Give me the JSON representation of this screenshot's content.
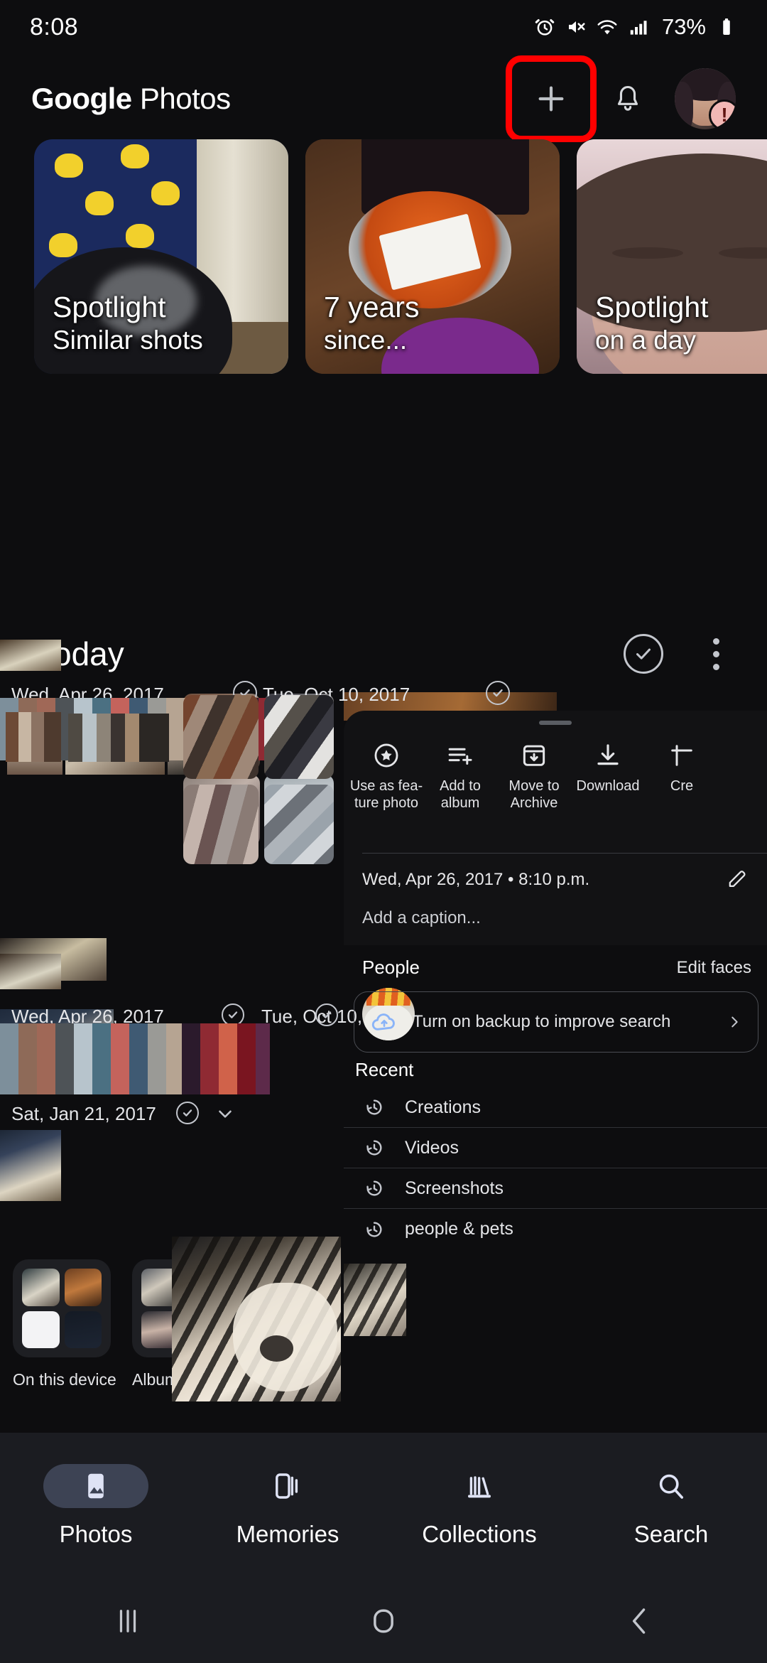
{
  "status_bar": {
    "time": "8:08",
    "battery": "73%",
    "icons": [
      "alarm-icon",
      "mute-icon",
      "wifi-icon",
      "signal-icon",
      "battery-icon"
    ]
  },
  "app_bar": {
    "brand_bold": "Google",
    "brand_light": " Photos",
    "add_label": "+",
    "highlight_color": "#ff0000",
    "notification_badge": "!"
  },
  "memories": [
    {
      "line1": "Spotlight",
      "line2": "Similar shots"
    },
    {
      "line1": "7 years",
      "line2": "since..."
    },
    {
      "line1": "Spotlight",
      "line2": "on a day"
    }
  ],
  "section": {
    "title": "Today"
  },
  "date_labels": [
    {
      "text": "Wed, Apr 26, 2017"
    },
    {
      "text": "Tue, Oct 10, 2017"
    },
    {
      "text": "Sat, Jan 21, 2017"
    }
  ],
  "overlay": {
    "actions": [
      {
        "icon": "star-circle-icon",
        "label": "Use as fea-\nture photo",
        "l1": "Use as fea-",
        "l2": "ture photo"
      },
      {
        "icon": "add-to-album-icon",
        "label": "Add to album",
        "l1": "Add to",
        "l2": "album"
      },
      {
        "icon": "archive-icon",
        "label": "Move to Archive",
        "l1": "Move to",
        "l2": "Archive"
      },
      {
        "icon": "download-icon",
        "label": "Download",
        "l1": "Download",
        "l2": ""
      },
      {
        "icon": "create-icon",
        "label": "Cre",
        "l1": "Cre",
        "l2": ""
      }
    ],
    "date": "Wed, Apr 26, 2017  •  8:10 p.m.",
    "caption_placeholder": "Add a caption..."
  },
  "people": {
    "title": "People",
    "edit_label": "Edit faces"
  },
  "backup_banner": {
    "text": "Turn on backup to improve search",
    "icon": "cloud-backup-icon",
    "chevron": "chevron-right-icon",
    "accent": "#8ab4f8"
  },
  "recent": {
    "title": "Recent",
    "items": [
      {
        "icon": "history-icon",
        "label": "Creations"
      },
      {
        "icon": "history-icon",
        "label": "Videos"
      },
      {
        "icon": "history-icon",
        "label": "Screenshots"
      },
      {
        "icon": "history-icon",
        "label": "people & pets"
      }
    ]
  },
  "shortcuts": [
    {
      "label": "On this device"
    },
    {
      "label": "Albums"
    }
  ],
  "bottom_nav": {
    "items": [
      {
        "label": "Photos",
        "icon": "photo-icon",
        "active": true
      },
      {
        "label": "Memories",
        "icon": "memories-icon",
        "active": false
      },
      {
        "label": "Collections",
        "icon": "collections-icon",
        "active": false
      },
      {
        "label": "Search",
        "icon": "search-icon",
        "active": false
      }
    ],
    "active_pill_color": "#3d4354"
  },
  "system_nav": {
    "items": [
      {
        "icon": "recents-icon"
      },
      {
        "icon": "home-icon"
      },
      {
        "icon": "back-icon"
      }
    ]
  }
}
